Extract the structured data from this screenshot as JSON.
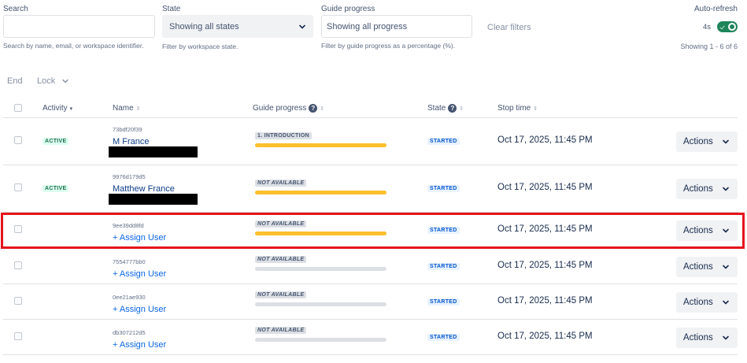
{
  "filters": {
    "search": {
      "label": "Search",
      "value": "",
      "placeholder": "",
      "help": "Search by name, email, or workspace identifier."
    },
    "state": {
      "label": "State",
      "value": "Showing all states",
      "help": "Filter by workspace state."
    },
    "progress": {
      "label": "Guide progress",
      "value": "Showing all progress",
      "help": "Filter by guide progress as a percentage (%)."
    },
    "clear_label": "Clear filters"
  },
  "autorefresh": {
    "label": "Auto-refresh",
    "interval": "4s",
    "enabled": true,
    "showing": "Showing 1 - 6 of 6"
  },
  "bulk": {
    "end_label": "End",
    "lock_label": "Lock"
  },
  "columns": {
    "activity": "Activity",
    "name": "Name",
    "guide": "Guide progress",
    "state": "State",
    "stop": "Stop time"
  },
  "rows": [
    {
      "activity": "ACTIVE",
      "workspace": "73bdf20f39",
      "name": "M France",
      "redacted": true,
      "guide": "1. INTRODUCTION",
      "progress": 1.0,
      "state": "STARTED",
      "stop": "Oct 17, 2025, 11:45 PM",
      "actions": "Actions"
    },
    {
      "activity": "ACTIVE",
      "workspace": "9976d179d5",
      "name": "Matthew France",
      "redacted": true,
      "guide": "NOT AVAILABLE",
      "progress": 1.0,
      "state": "STARTED",
      "stop": "Oct 17, 2025, 11:45 PM",
      "actions": "Actions"
    },
    {
      "activity": "",
      "workspace": "9ee39dd8fd",
      "name": "+ Assign User",
      "redacted": false,
      "guide": "NOT AVAILABLE",
      "progress": 1.0,
      "state": "STARTED",
      "stop": "Oct 17, 2025, 11:45 PM",
      "actions": "Actions"
    },
    {
      "activity": "",
      "workspace": "7554777bb0",
      "name": "+ Assign User",
      "redacted": false,
      "guide": "NOT AVAILABLE",
      "progress": 0,
      "state": "STARTED",
      "stop": "Oct 17, 2025, 11:45 PM",
      "actions": "Actions"
    },
    {
      "activity": "",
      "workspace": "0ee21ae930",
      "name": "+ Assign User",
      "redacted": false,
      "guide": "NOT AVAILABLE",
      "progress": 0,
      "state": "STARTED",
      "stop": "Oct 17, 2025, 11:45 PM",
      "actions": "Actions"
    },
    {
      "activity": "",
      "workspace": "db307212d5",
      "name": "+ Assign User",
      "redacted": false,
      "guide": "NOT AVAILABLE",
      "progress": 0,
      "state": "STARTED",
      "stop": "Oct 17, 2025, 11:45 PM",
      "actions": "Actions"
    }
  ],
  "colors": {
    "highlight": "#e5141c",
    "progress_fill": "#fbc02d",
    "progress_empty": "#dcdfe4",
    "toggle_on": "#1f845a"
  }
}
